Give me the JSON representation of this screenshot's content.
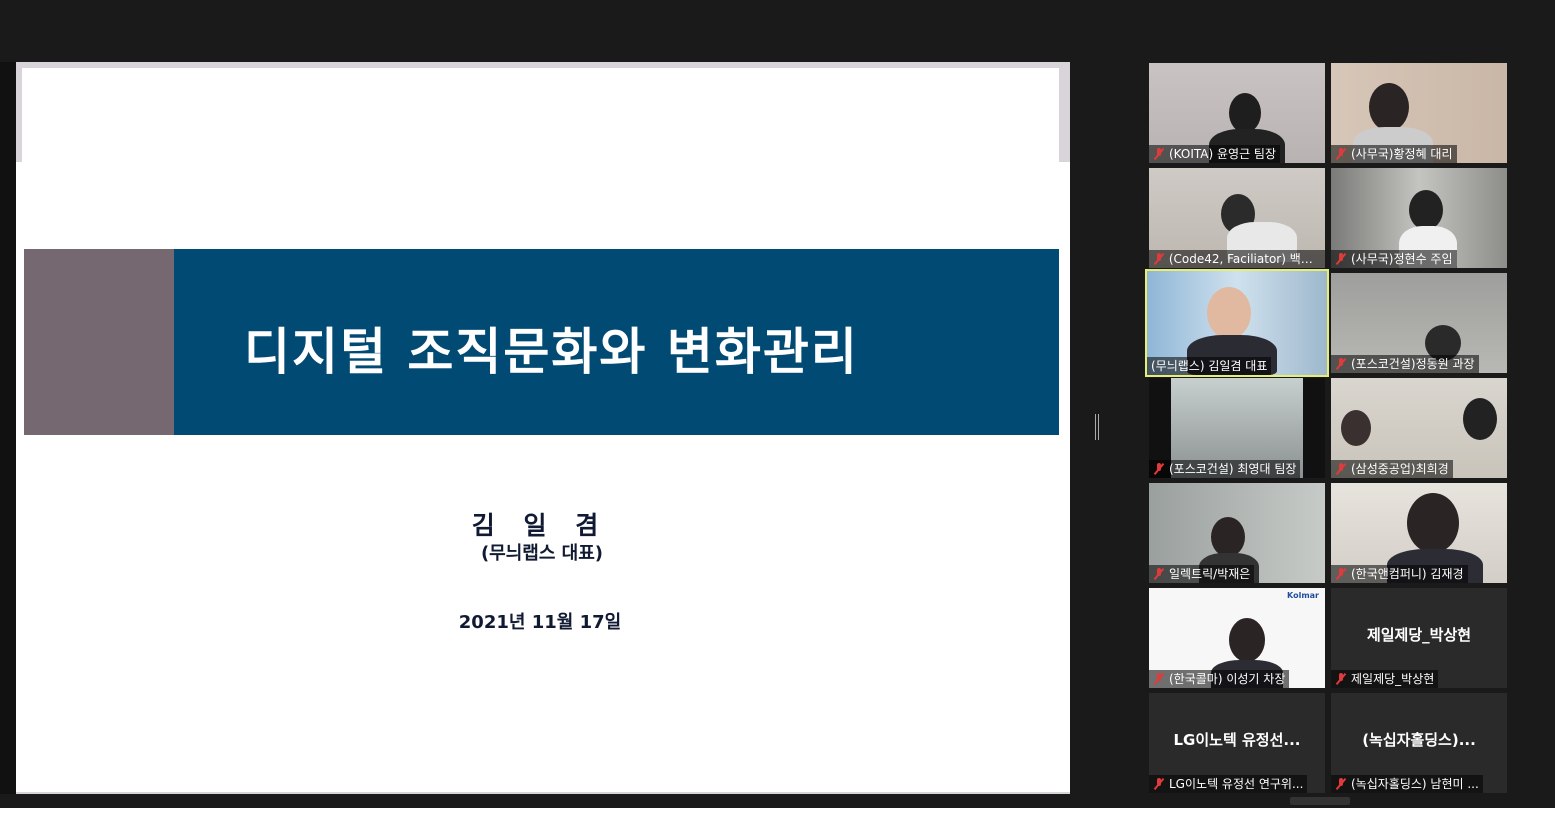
{
  "slide": {
    "title": "디지털 조직문화와 변화관리",
    "presenter_name": "김 일 겸",
    "presenter_role": "(무늬랩스 대표)",
    "date": "2021년 11월 17일"
  },
  "participants": [
    {
      "label": "(KOITA) 윤영근 팀장",
      "center_name": "",
      "muted": true
    },
    {
      "label": "(사무국)황정혜 대리",
      "center_name": "",
      "muted": true
    },
    {
      "label": "(Code42, Faciliator) 백성...",
      "center_name": "",
      "muted": true
    },
    {
      "label": "(사무국)정현수 주임",
      "center_name": "",
      "muted": true
    },
    {
      "label": "(무늬랩스) 김일겸 대표",
      "center_name": "",
      "muted": false,
      "active_speaker": true
    },
    {
      "label": "(포스코건설)정동원 과장",
      "center_name": "",
      "muted": true
    },
    {
      "label": "(포스코건설) 최영대 팀장",
      "center_name": "",
      "muted": true
    },
    {
      "label": "(삼성중공업)최희경",
      "center_name": "",
      "muted": true
    },
    {
      "label": "일렉트릭/박재은",
      "center_name": "",
      "muted": true
    },
    {
      "label": "(한국앤컴퍼니) 김재경",
      "center_name": "",
      "muted": true
    },
    {
      "label": "(한국콜마) 이성기 차장",
      "center_name": "",
      "muted": true,
      "logo_text": "Kolmar"
    },
    {
      "label": "제일제당_박상현",
      "center_name": "제일제당_박상현",
      "muted": true
    },
    {
      "label": "LG이노텍 유정선 연구위...",
      "center_name": "LG이노텍 유정선...",
      "muted": true
    },
    {
      "label": "(녹십자홀딩스) 남현미 ...",
      "center_name": "(녹십자홀딩스)...",
      "muted": true
    }
  ],
  "colors": {
    "title_band": "#004a73",
    "title_accent": "#756871",
    "active_speaker_border": "#e6ef74",
    "muted_icon": "#e13a3a"
  }
}
